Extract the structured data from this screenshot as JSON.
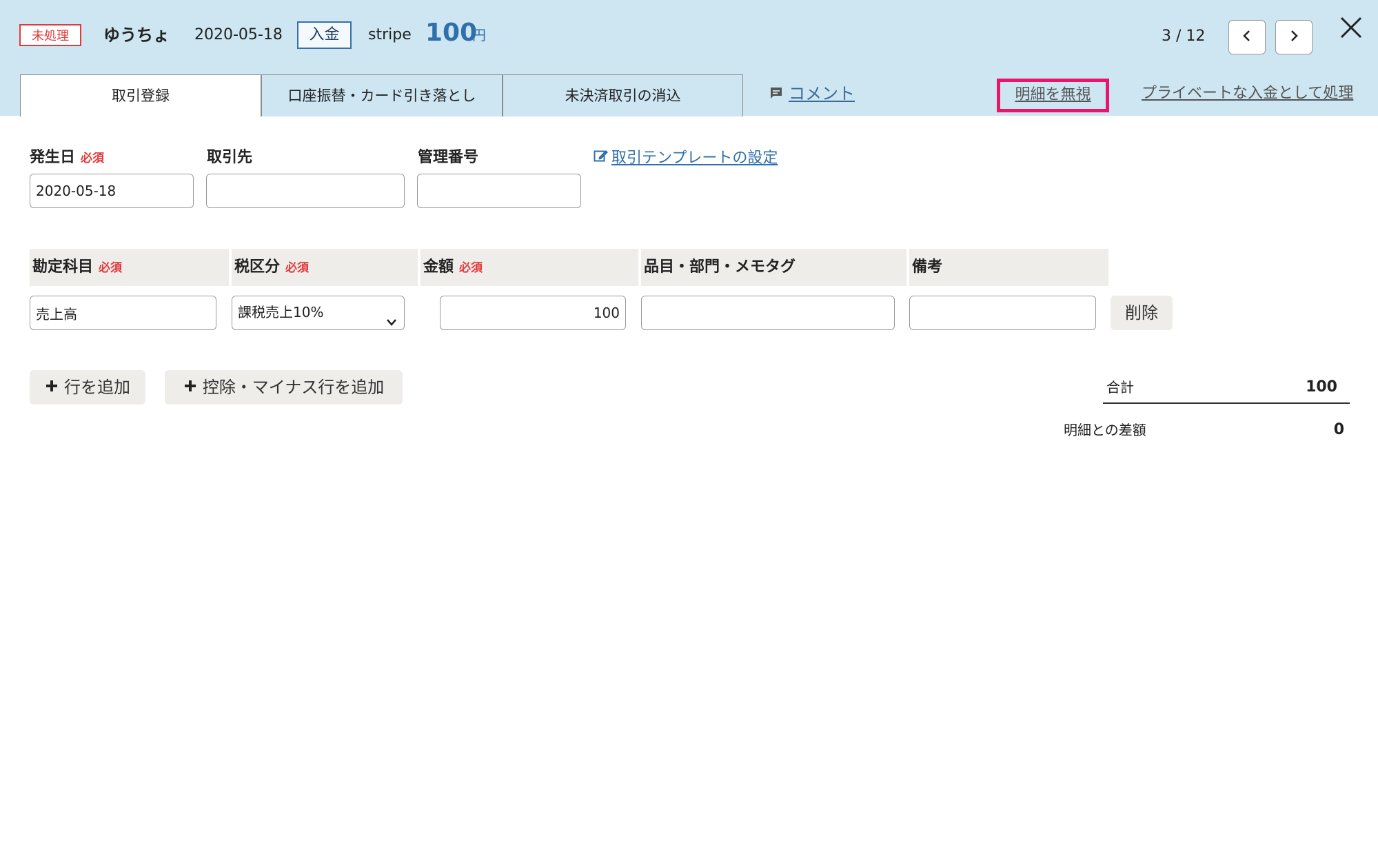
{
  "header": {
    "status": "未処理",
    "account_name": "ゆうちょ",
    "date": "2020-05-18",
    "type": "入金",
    "source": "stripe",
    "amount": "100",
    "currency": "円",
    "pager": "3 / 12"
  },
  "tabs": [
    {
      "label": "取引登録",
      "active": true
    },
    {
      "label": "口座振替・カード引き落とし",
      "active": false
    },
    {
      "label": "未決済取引の消込",
      "active": false
    }
  ],
  "links": {
    "comment": "コメント",
    "ignore": "明細を無視",
    "private": "プライベートな入金として処理",
    "template": "取引テンプレートの設定"
  },
  "form": {
    "date_label": "発生日",
    "required": "必須",
    "date_value": "2020-05-18",
    "partner_label": "取引先",
    "partner_value": "",
    "ref_label": "管理番号",
    "ref_value": ""
  },
  "table": {
    "headers": {
      "account": "勘定科目",
      "tax": "税区分",
      "amount": "金額",
      "tags": "品目・部門・メモタグ",
      "note": "備考"
    },
    "row": {
      "account": "売上高",
      "tax": "課税売上10%",
      "amount": "100",
      "tags": "",
      "note": ""
    },
    "delete_label": "削除"
  },
  "actions": {
    "add_row": "行を追加",
    "add_deduction": "控除・マイナス行を追加"
  },
  "totals": {
    "total_label": "合計",
    "total_value": "100",
    "diff_label": "明細との差額",
    "diff_value": "0"
  },
  "colors": {
    "header_bg": "#cde6f2",
    "required": "#e03a3a",
    "amount": "#2f6fab",
    "highlight": "#e8156a"
  }
}
